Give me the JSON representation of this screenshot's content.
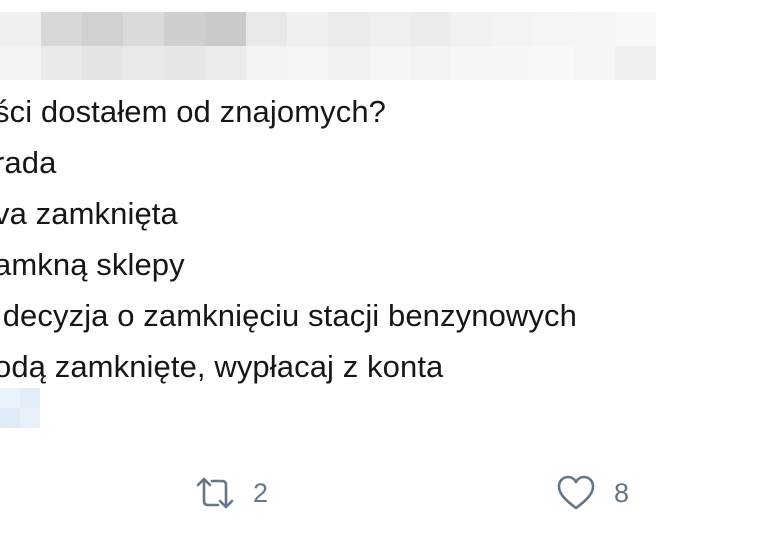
{
  "tweet": {
    "lines": [
      "ści dostałem od znajomych?",
      "rada",
      "va zamknięta",
      "amkną sklepy",
      " decyzja o zamknięciu stacji benzynowych",
      "odą zamknięte, wypłacaj z konta"
    ]
  },
  "actions": {
    "retweet_count": "2",
    "like_count": "8",
    "retweet_icon": "retweet-icon",
    "like_icon": "heart-icon"
  },
  "colors": {
    "text": "#14171a",
    "muted": "#657786",
    "censor_palette": [
      "#e6e9ec",
      "#d9dde1",
      "#cdd1d5",
      "#f0f2f4",
      "#c4c8cc",
      "#f5f7fa",
      "#dfe6ef"
    ]
  }
}
